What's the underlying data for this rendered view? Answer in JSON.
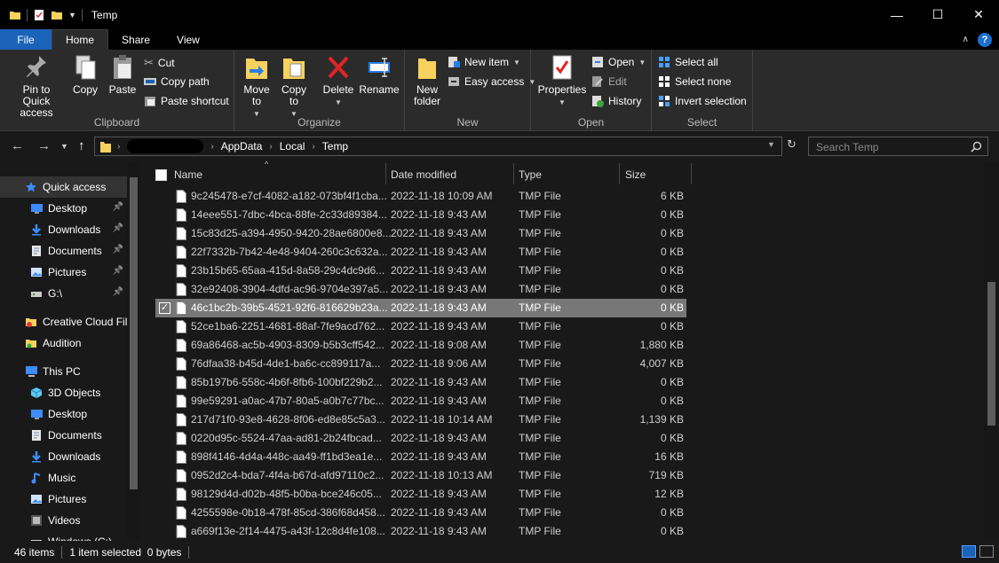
{
  "window": {
    "title": "Temp"
  },
  "tabs": {
    "file": "File",
    "home": "Home",
    "share": "Share",
    "view": "View"
  },
  "ribbon": {
    "clipboard": {
      "label": "Clipboard",
      "pin": "Pin to Quick access",
      "copy": "Copy",
      "paste": "Paste",
      "cut": "Cut",
      "copy_path": "Copy path",
      "paste_shortcut": "Paste shortcut"
    },
    "organize": {
      "label": "Organize",
      "move_to": "Move to",
      "copy_to": "Copy to",
      "delete": "Delete",
      "rename": "Rename"
    },
    "new": {
      "label": "New",
      "new_folder": "New folder",
      "new_item": "New item",
      "easy_access": "Easy access"
    },
    "open": {
      "label": "Open",
      "properties": "Properties",
      "open": "Open",
      "edit": "Edit",
      "history": "History"
    },
    "select": {
      "label": "Select",
      "select_all": "Select all",
      "select_none": "Select none",
      "invert": "Invert selection"
    }
  },
  "address": {
    "crumbs": [
      "AppData",
      "Local",
      "Temp"
    ]
  },
  "search": {
    "placeholder": "Search Temp"
  },
  "nav": [
    {
      "label": "Quick access",
      "icon": "star-icon",
      "selected": true
    },
    {
      "label": "Desktop",
      "icon": "desktop-icon",
      "pinned": true
    },
    {
      "label": "Downloads",
      "icon": "download-icon",
      "pinned": true
    },
    {
      "label": "Documents",
      "icon": "documents-icon",
      "pinned": true
    },
    {
      "label": "Pictures",
      "icon": "pictures-icon",
      "pinned": true
    },
    {
      "label": "G:\\",
      "icon": "drive-icon",
      "pinned": true
    },
    {
      "label": "Creative Cloud Fil",
      "icon": "creative-cloud-icon"
    },
    {
      "label": "Audition",
      "icon": "folder-icon"
    },
    {
      "label": "This PC",
      "icon": "computer-icon"
    },
    {
      "label": "3D Objects",
      "icon": "cube-icon"
    },
    {
      "label": "Desktop",
      "icon": "desktop-icon"
    },
    {
      "label": "Documents",
      "icon": "documents-icon"
    },
    {
      "label": "Downloads",
      "icon": "download-icon"
    },
    {
      "label": "Music",
      "icon": "music-icon"
    },
    {
      "label": "Pictures",
      "icon": "pictures-icon"
    },
    {
      "label": "Videos",
      "icon": "videos-icon"
    },
    {
      "label": "Windows (C:)",
      "icon": "drive-icon"
    }
  ],
  "columns": {
    "name": "Name",
    "date": "Date modified",
    "type": "Type",
    "size": "Size"
  },
  "files": [
    {
      "name": "9c245478-e7cf-4082-a182-073bf4f1cba...",
      "date": "2022-11-18 10:09 AM",
      "type": "TMP File",
      "size": "6 KB"
    },
    {
      "name": "14eee551-7dbc-4bca-88fe-2c33d89384...",
      "date": "2022-11-18 9:43 AM",
      "type": "TMP File",
      "size": "0 KB"
    },
    {
      "name": "15c83d25-a394-4950-9420-28ae6800e8...",
      "date": "2022-11-18 9:43 AM",
      "type": "TMP File",
      "size": "0 KB"
    },
    {
      "name": "22f7332b-7b42-4e48-9404-260c3c632a...",
      "date": "2022-11-18 9:43 AM",
      "type": "TMP File",
      "size": "0 KB"
    },
    {
      "name": "23b15b65-65aa-415d-8a58-29c4dc9d6...",
      "date": "2022-11-18 9:43 AM",
      "type": "TMP File",
      "size": "0 KB"
    },
    {
      "name": "32e92408-3904-4dfd-ac96-9704e397a5...",
      "date": "2022-11-18 9:43 AM",
      "type": "TMP File",
      "size": "0 KB"
    },
    {
      "name": "46c1bc2b-39b5-4521-92f6-816629b23a...",
      "date": "2022-11-18 9:43 AM",
      "type": "TMP File",
      "size": "0 KB",
      "selected": true
    },
    {
      "name": "52ce1ba6-2251-4681-88af-7fe9acd762...",
      "date": "2022-11-18 9:43 AM",
      "type": "TMP File",
      "size": "0 KB"
    },
    {
      "name": "69a86468-ac5b-4903-8309-b5b3cff542...",
      "date": "2022-11-18 9:08 AM",
      "type": "TMP File",
      "size": "1,880 KB"
    },
    {
      "name": "76dfaa38-b45d-4de1-ba6c-cc899117a...",
      "date": "2022-11-18 9:06 AM",
      "type": "TMP File",
      "size": "4,007 KB"
    },
    {
      "name": "85b197b6-558c-4b6f-8fb6-100bf229b2...",
      "date": "2022-11-18 9:43 AM",
      "type": "TMP File",
      "size": "0 KB"
    },
    {
      "name": "99e59291-a0ac-47b7-80a5-a0b7c77bc...",
      "date": "2022-11-18 9:43 AM",
      "type": "TMP File",
      "size": "0 KB"
    },
    {
      "name": "217d71f0-93e8-4628-8f06-ed8e85c5a3...",
      "date": "2022-11-18 10:14 AM",
      "type": "TMP File",
      "size": "1,139 KB"
    },
    {
      "name": "0220d95c-5524-47aa-ad81-2b24fbcad...",
      "date": "2022-11-18 9:43 AM",
      "type": "TMP File",
      "size": "0 KB"
    },
    {
      "name": "898f4146-4d4a-448c-aa49-ff1bd3ea1e...",
      "date": "2022-11-18 9:43 AM",
      "type": "TMP File",
      "size": "16 KB"
    },
    {
      "name": "0952d2c4-bda7-4f4a-b67d-afd97110c2...",
      "date": "2022-11-18 10:13 AM",
      "type": "TMP File",
      "size": "719 KB"
    },
    {
      "name": "98129d4d-d02b-48f5-b0ba-bce246c05...",
      "date": "2022-11-18 9:43 AM",
      "type": "TMP File",
      "size": "12 KB"
    },
    {
      "name": "4255598e-0b18-478f-85cd-386f68d458...",
      "date": "2022-11-18 9:43 AM",
      "type": "TMP File",
      "size": "0 KB"
    },
    {
      "name": "a669f13e-2f14-4475-a43f-12c8d4fe108...",
      "date": "2022-11-18 9:43 AM",
      "type": "TMP File",
      "size": "0 KB"
    }
  ],
  "status": {
    "count": "46 items",
    "selection": "1 item selected  0 bytes"
  },
  "colors": {
    "accent": "#1a63b8",
    "background": "#191919",
    "ribbon": "#2b2b2b",
    "folder": "#f7d25c",
    "selected_row": "#777777"
  }
}
